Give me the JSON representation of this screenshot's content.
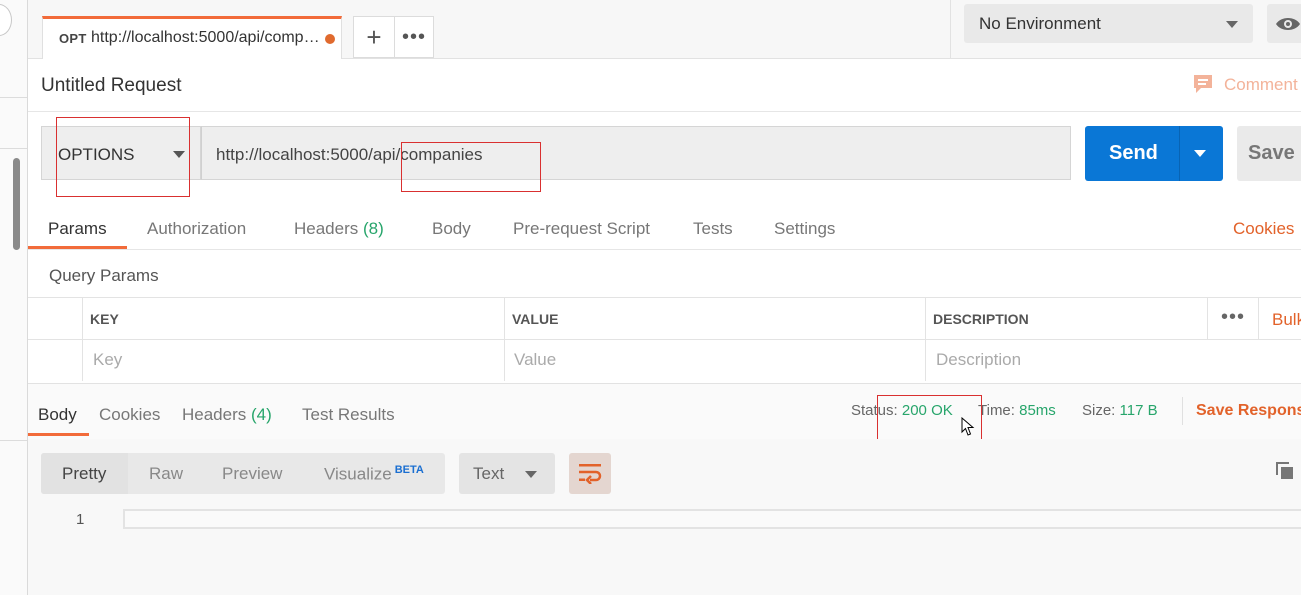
{
  "tabs": {
    "active": {
      "method": "OPT",
      "url": "http://localhost:5000/api/comp…",
      "unsaved": true
    }
  },
  "environment": {
    "selected": "No Environment"
  },
  "request": {
    "title": "Untitled Request",
    "comment_label": "Comment",
    "method": "OPTIONS",
    "url": "http://localhost:5000/api/companies",
    "send_label": "Send",
    "save_label": "Save"
  },
  "request_tabs": [
    {
      "label": "Params",
      "active": true
    },
    {
      "label": "Authorization"
    },
    {
      "label": "Headers",
      "count": "(8)"
    },
    {
      "label": "Body"
    },
    {
      "label": "Pre-request Script"
    },
    {
      "label": "Tests"
    },
    {
      "label": "Settings"
    }
  ],
  "cookies_link": "Cookies",
  "query_params": {
    "title": "Query Params",
    "columns": [
      "KEY",
      "VALUE",
      "DESCRIPTION"
    ],
    "placeholders": [
      "Key",
      "Value",
      "Description"
    ],
    "bulk_edit": "Bulk Edit"
  },
  "response_tabs": [
    {
      "label": "Body",
      "active": true
    },
    {
      "label": "Cookies"
    },
    {
      "label": "Headers",
      "count": "(4)"
    },
    {
      "label": "Test Results"
    }
  ],
  "response_meta": {
    "status_label": "Status:",
    "status_value": "200 OK",
    "time_label": "Time:",
    "time_value": "85ms",
    "size_label": "Size:",
    "size_value": "117 B",
    "save_response": "Save Response"
  },
  "formats": [
    {
      "label": "Pretty",
      "active": true
    },
    {
      "label": "Raw"
    },
    {
      "label": "Preview"
    },
    {
      "label": "Visualize",
      "badge": "BETA"
    }
  ],
  "content_type": "Text",
  "editor": {
    "line_numbers": [
      "1"
    ]
  },
  "colors": {
    "accent": "#f26b3a",
    "send": "#0a77d6",
    "success": "#27a56b",
    "link": "#e2622a"
  }
}
